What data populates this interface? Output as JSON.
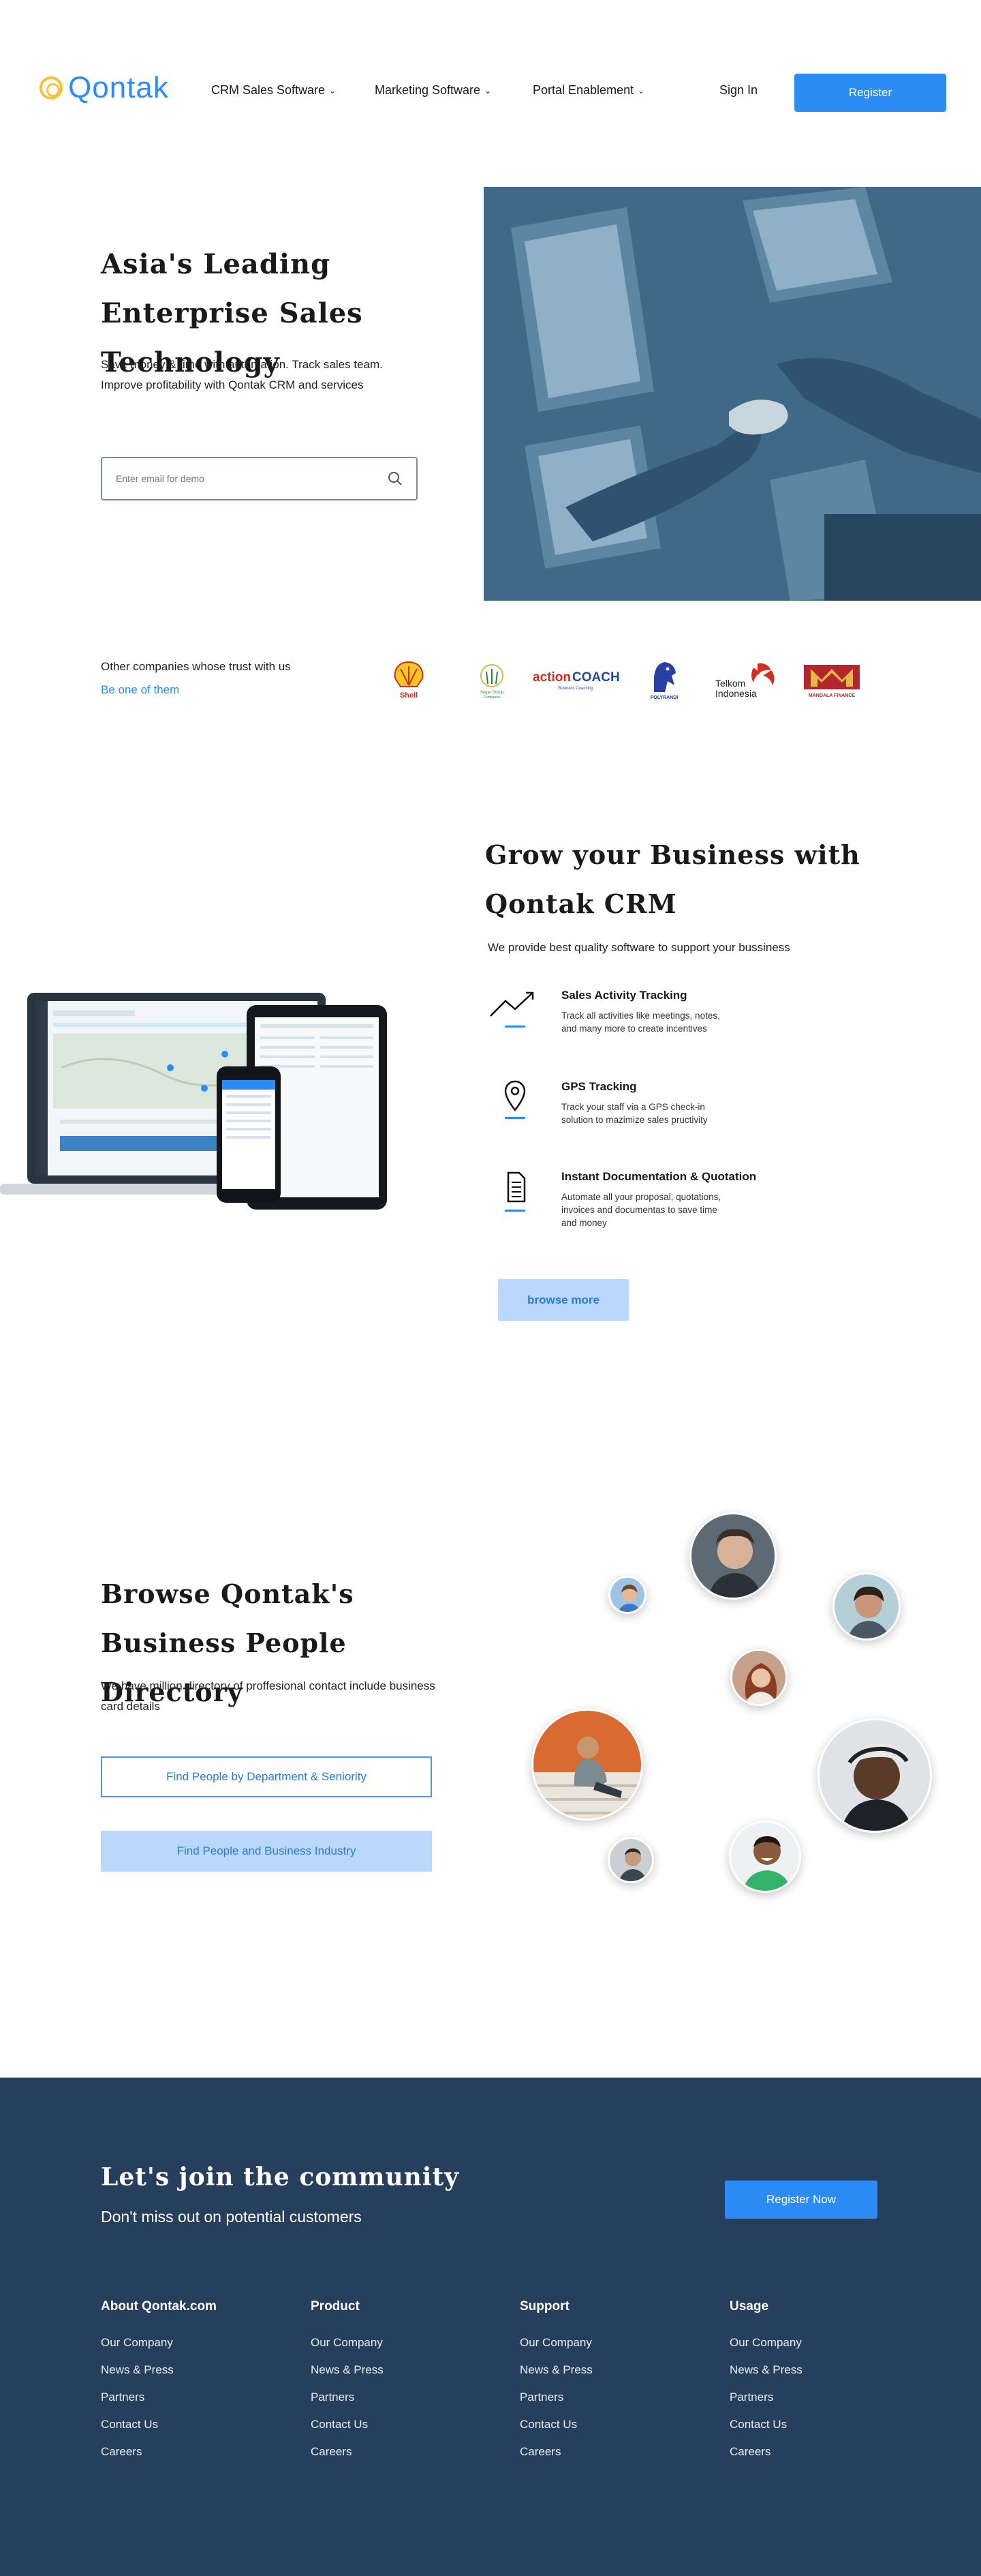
{
  "nav": {
    "logo_text": "Qontak",
    "items": [
      {
        "label": "CRM Sales Software"
      },
      {
        "label": "Marketing Software"
      },
      {
        "label": "Portal Enablement"
      }
    ],
    "chevron": "⌄",
    "sign_in": "Sign In",
    "register": "Register"
  },
  "hero": {
    "title": "Asia's Leading Enterprise Sales Technology",
    "description": "Save money & time with automation. Track sales team. Improve profitability with Qontak CRM and services",
    "email_placeholder": "Enter email for demo",
    "image_icon": "handshake-office-photo"
  },
  "trust": {
    "text": "Other companies whose trust with us",
    "link": "Be one of them",
    "brands": [
      {
        "name": "Shell",
        "color": "#d62b1f"
      },
      {
        "name": "Sugar Group Companies",
        "color": "#2a8a3a"
      },
      {
        "name": "actionCOACH",
        "color": "#d62b1f"
      },
      {
        "name": "POLYRANDI",
        "color": "#2a3fa6"
      },
      {
        "name": "Telkom Indonesia",
        "color": "#d62b1f"
      },
      {
        "name": "MANDALA FINANCE",
        "color": "#b3262e"
      }
    ]
  },
  "crm": {
    "title": "Grow your Business with Qontak CRM",
    "subtitle": "We provide best quality software to support your bussiness",
    "features": [
      {
        "title": "Sales Activity Tracking",
        "desc": "Track all activities like meetings, notes, and many more to create incentives",
        "icon": "chart-line-icon"
      },
      {
        "title": "GPS Tracking",
        "desc": "Track your staff via a GPS check-in solution to mazimize sales pructivity",
        "icon": "map-pin-icon"
      },
      {
        "title": "Instant Documentation & Quotation",
        "desc": "Automate all your proposal, quotations, invoices and documentas to save time and money",
        "icon": "document-icon"
      }
    ],
    "browse": "browse more"
  },
  "directory": {
    "title": "Browse Qontak's Business People Directory",
    "description": "We have million directory of proffesional contact include business card details",
    "btn_department": "Find People by Department & Seniority",
    "btn_industry": "Find People and Business Industry"
  },
  "footer": {
    "title": "Let's join the community",
    "subtitle": "Don't miss out on potential customers",
    "register_now": "Register Now",
    "columns": [
      {
        "heading": "About Qontak.com",
        "links": [
          "Our Company",
          "News & Press",
          "Partners",
          "Contact Us",
          "Careers"
        ]
      },
      {
        "heading": "Product",
        "links": [
          "Our Company",
          "News & Press",
          "Partners",
          "Contact Us",
          "Careers"
        ]
      },
      {
        "heading": "Support",
        "links": [
          "Our Company",
          "News & Press",
          "Partners",
          "Contact Us",
          "Careers"
        ]
      },
      {
        "heading": "Usage",
        "links": [
          "Our Company",
          "News & Press",
          "Partners",
          "Contact Us",
          "Careers"
        ]
      }
    ]
  },
  "colors": {
    "accent": "#2a8cf4",
    "footer_bg": "#253f5c",
    "light_button": "#b9d8fb"
  }
}
